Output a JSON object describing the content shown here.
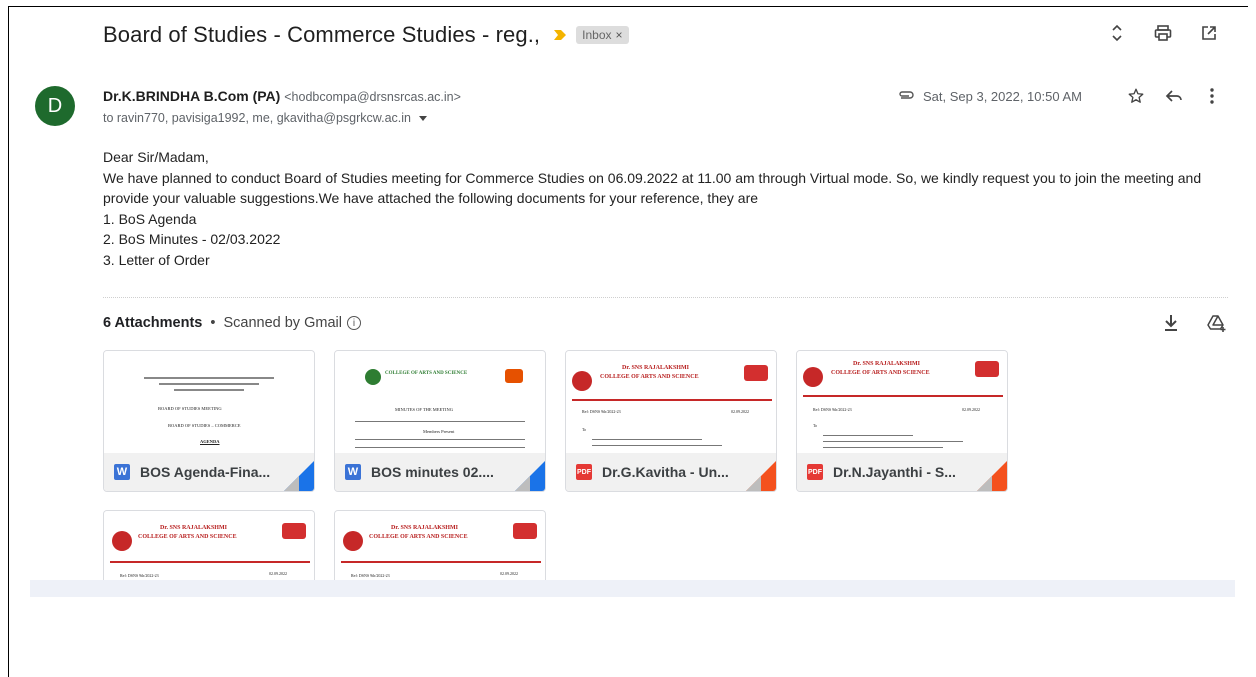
{
  "subject": "Board of Studies - Commerce Studies - reg.,",
  "label_chip": "Inbox",
  "label_chip_close": "×",
  "avatar_letter": "D",
  "sender_name": "Dr.K.BRINDHA B.Com (PA)",
  "sender_email": "<hodbcompa@drsnsrcas.ac.in>",
  "recipients": "to ravin770, pavisiga1992, me, gkavitha@psgrkcw.ac.in",
  "date": "Sat, Sep 3, 2022, 10:50 AM",
  "icons": {
    "top": [
      "expand-collapse-icon",
      "print-icon",
      "open-new-window-icon"
    ],
    "meta": [
      "attachment-icon",
      "star-icon",
      "reply-icon",
      "more-vert-icon"
    ],
    "attachments": [
      "download-all-icon",
      "add-to-drive-icon"
    ]
  },
  "body": {
    "greeting": "Dear Sir/Madam,",
    "paragraph": "We have planned to conduct Board of Studies meeting for Commerce Studies on 06.09.2022 at 11.00 am through Virtual mode. So, we kindly request you to join the meeting and provide your valuable suggestions.We have attached the following documents for your reference, they are",
    "items": [
      "1. BoS Agenda",
      "2. BoS Minutes - 02/03.2022",
      "3. Letter of Order"
    ]
  },
  "attachments_header": {
    "count": "6 Attachments",
    "separator": "•",
    "scanned": "Scanned by Gmail",
    "info_glyph": "i"
  },
  "attachments": [
    {
      "name": "BOS Agenda-Fina...",
      "type": "W",
      "kind": "word",
      "corner_color": "#1a73e8"
    },
    {
      "name": "BOS minutes 02....",
      "type": "W",
      "kind": "word",
      "corner_color": "#1a73e8"
    },
    {
      "name": "Dr.G.Kavitha - Un...",
      "type": "PDF",
      "kind": "pdf",
      "corner_color": "#f4511e"
    },
    {
      "name": "Dr.N.Jayanthi - S...",
      "type": "PDF",
      "kind": "pdf",
      "corner_color": "#f4511e"
    },
    {
      "name": "",
      "type": "PDF",
      "kind": "pdf",
      "corner_color": "#f4511e"
    },
    {
      "name": "",
      "type": "PDF",
      "kind": "pdf",
      "corner_color": "#f4511e"
    }
  ],
  "thumb_text": {
    "college_line1": "Dr. SNS RAJALAKSHMI",
    "college_line2": "COLLEGE OF ARTS AND SCIENCE",
    "agenda_title": "BOARD OF STUDIES MEETING",
    "agenda_sub": "BOARD OF STUDIES – COMMERCE",
    "agenda_word": "AGENDA",
    "minutes_title": "MINUTES OF THE MEETING",
    "members": "Members Present",
    "ref": "Ref: DSNS 9th/2022-23",
    "date_ref": "02.09.2022",
    "to": "To"
  }
}
